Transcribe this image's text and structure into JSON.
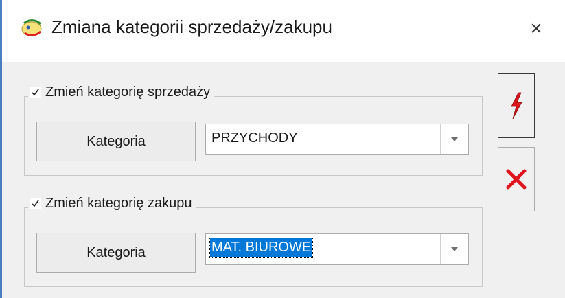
{
  "window": {
    "title": "Zmiana kategorii sprzedaży/zakupu",
    "close_symbol": "×"
  },
  "sales_group": {
    "checkbox_label": "Zmień kategorię sprzedaży",
    "checked": true,
    "button_label": "Kategoria",
    "selected_value": "PRZYCHODY"
  },
  "purchase_group": {
    "checkbox_label": "Zmień kategorię zakupu",
    "checked": true,
    "button_label": "Kategoria",
    "selected_value": "MAT. BIUROWE"
  },
  "actions": {
    "confirm_icon": "lightning-icon",
    "cancel_icon": "red-x-icon"
  },
  "colors": {
    "accent": "#0078d7",
    "confirm_red": "#d9141b",
    "cancel_red": "#e0141e",
    "window_border": "#4a7fc1"
  }
}
